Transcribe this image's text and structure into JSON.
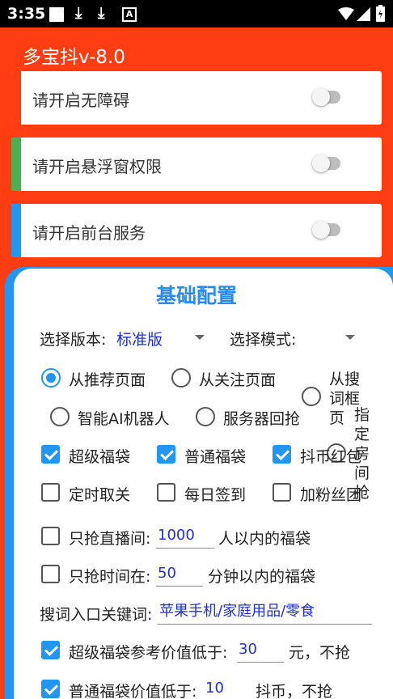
{
  "status": {
    "time": "3:35"
  },
  "app": {
    "title": "多宝抖v-8.0"
  },
  "cards": [
    {
      "label": "请开启无障碍",
      "color": "#ff3d12"
    },
    {
      "label": "请开启悬浮窗权限",
      "color": "#4caf50"
    },
    {
      "label": "请开启前台服务",
      "color": "#2196f3"
    }
  ],
  "panel": {
    "title": "基础配置",
    "version_label": "选择版本:",
    "version_value": "标准版",
    "mode_label": "选择模式:",
    "radios": [
      "从推荐页面",
      "从关注页面",
      "从搜词框页",
      "智能AI机器人",
      "服务器回抢",
      "指定房间抢"
    ],
    "checks1": [
      "超级福袋",
      "普通福袋",
      "抖币红包"
    ],
    "checks2": [
      "定时取关",
      "每日签到",
      "加粉丝团"
    ],
    "live_label": "只抢直播间:",
    "live_value": "1000",
    "live_suffix": "人以内的福袋",
    "time_label": "只抢时间在:",
    "time_value": "50",
    "time_suffix": "分钟以内的福袋",
    "keyword_label": "搜词入口关键词:",
    "keyword_value": "苹果手机/家庭用品/零食",
    "super_label": "超级福袋参考价值低于:",
    "super_value": "30",
    "super_suffix": "元，不抢",
    "normal_label": "普通福袋价值低于:",
    "normal_value": "10",
    "normal_suffix": "抖币，不抢"
  }
}
